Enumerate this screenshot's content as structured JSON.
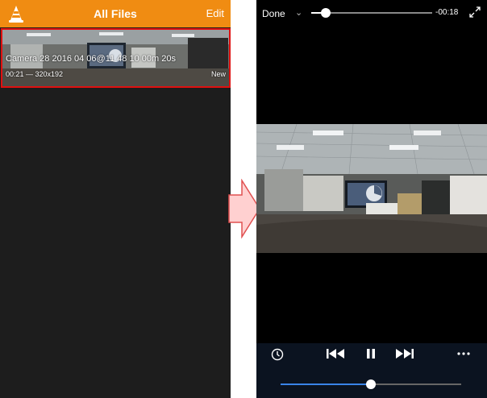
{
  "library": {
    "title": "All Files",
    "edit_label": "Edit",
    "file": {
      "name": "Camera 28 2016 04 06@11 48 10 00m 20s",
      "meta": "00:21 — 320x192",
      "badge": "New"
    }
  },
  "player": {
    "done_label": "Done",
    "chevron": "⌄",
    "time_remaining": "-00:18",
    "playback_progress": 0.12,
    "volume_level": 0.5
  },
  "colors": {
    "header_orange": "#f08c12",
    "selection_red": "#e01010",
    "volume_blue": "#3a84e8",
    "arrow_fill": "#ffd0d0",
    "arrow_stroke": "#e05050"
  }
}
